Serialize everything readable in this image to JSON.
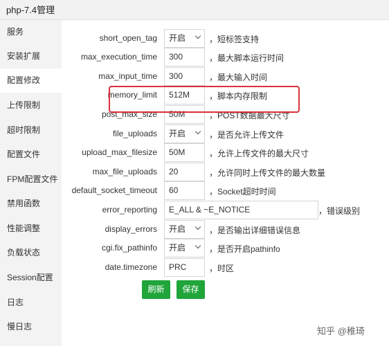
{
  "window": {
    "title": "php-7.4管理"
  },
  "sidebar": {
    "items": [
      {
        "label": "服务",
        "active": false
      },
      {
        "label": "安装扩展",
        "active": false
      },
      {
        "label": "配置修改",
        "active": true
      },
      {
        "label": "上传限制",
        "active": false
      },
      {
        "label": "超时限制",
        "active": false
      },
      {
        "label": "配置文件",
        "active": false
      },
      {
        "label": "FPM配置文件",
        "active": false
      },
      {
        "label": "禁用函数",
        "active": false
      },
      {
        "label": "性能调整",
        "active": false
      },
      {
        "label": "负载状态",
        "active": false
      },
      {
        "label": "Session配置",
        "active": false
      },
      {
        "label": "日志",
        "active": false
      },
      {
        "label": "慢日志",
        "active": false
      }
    ]
  },
  "settings": [
    {
      "name": "short_open_tag",
      "type": "select",
      "value": "开启",
      "desc": "，短标签支持"
    },
    {
      "name": "max_execution_time",
      "type": "input",
      "value": "300",
      "desc": "，最大脚本运行时间"
    },
    {
      "name": "max_input_time",
      "type": "input",
      "value": "300",
      "desc": "，最大输入时间"
    },
    {
      "name": "memory_limit",
      "type": "input",
      "value": "512M",
      "desc": "，脚本内存限制"
    },
    {
      "name": "post_max_size",
      "type": "input",
      "value": "50M",
      "desc": "，POST数据最大尺寸"
    },
    {
      "name": "file_uploads",
      "type": "select",
      "value": "开启",
      "desc": "，是否允许上传文件"
    },
    {
      "name": "upload_max_filesize",
      "type": "input",
      "value": "50M",
      "desc": "，允许上传文件的最大尺寸"
    },
    {
      "name": "max_file_uploads",
      "type": "input",
      "value": "20",
      "desc": "，允许同时上传文件的最大数量"
    },
    {
      "name": "default_socket_timeout",
      "type": "input",
      "value": "60",
      "desc": "，Socket超时时间"
    },
    {
      "name": "error_reporting",
      "type": "input-wide",
      "value": "E_ALL & ~E_NOTICE",
      "desc": "，错误级别"
    },
    {
      "name": "display_errors",
      "type": "select",
      "value": "开启",
      "desc": "，是否输出详细错误信息"
    },
    {
      "name": "cgi.fix_pathinfo",
      "type": "select",
      "value": "开启",
      "desc": "，是否开启pathinfo"
    },
    {
      "name": "date.timezone",
      "type": "input",
      "value": "PRC",
      "desc": "，时区"
    }
  ],
  "buttons": {
    "refresh": "刷新",
    "save": "保存"
  },
  "watermark": "知乎 @稚琦",
  "colors": {
    "accent": "#20a53a",
    "highlight": "#d9303a"
  }
}
